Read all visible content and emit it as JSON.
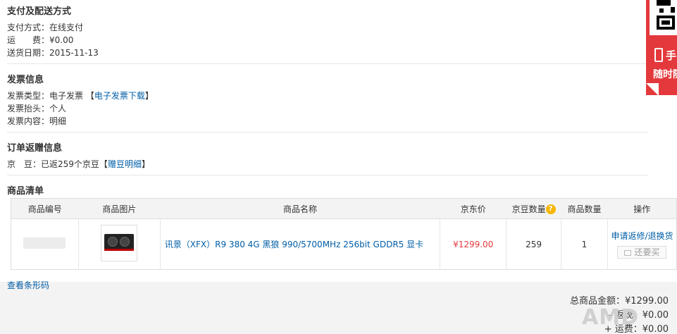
{
  "payment": {
    "title": "支付及配送方式",
    "method_label": "支付方式：",
    "method_value": "在线支付",
    "freight_label": "运　　费：",
    "freight_value": "¥0.00",
    "date_label": "送货日期：",
    "date_value": "2015-11-13"
  },
  "invoice": {
    "title": "发票信息",
    "type_label": "发票类型：",
    "type_value": "电子发票",
    "download_link": "电子发票下载",
    "header_label": "发票抬头：",
    "header_value": "个人",
    "content_label": "发票内容：",
    "content_value": "明细"
  },
  "beans": {
    "title": "订单返赠信息",
    "label": "京　豆：",
    "value": "已返259个京豆",
    "detail_link": "赠豆明细"
  },
  "goods": {
    "title": "商品清单",
    "columns": [
      "商品编号",
      "商品图片",
      "商品名称",
      "京东价",
      "京豆数量",
      "商品数量",
      "操作"
    ],
    "row": {
      "name": "讯景（XFX）R9 380 4G 黑狼 990/5700MHz 256bit GDDR5 显卡",
      "price": "¥1299.00",
      "beans": "259",
      "quantity": "1",
      "repair_link": "申请返修/退换货",
      "rebuy": "还要买"
    }
  },
  "barcode_link": "查看条形码",
  "totals": {
    "goods_total": "总商品金额：¥1299.00",
    "rebate": "- 返现：¥0.00",
    "freight": "+ 运费：¥0.00"
  },
  "ad": {
    "line1": "手",
    "line2": "随时随"
  },
  "watermark": "AMD"
}
